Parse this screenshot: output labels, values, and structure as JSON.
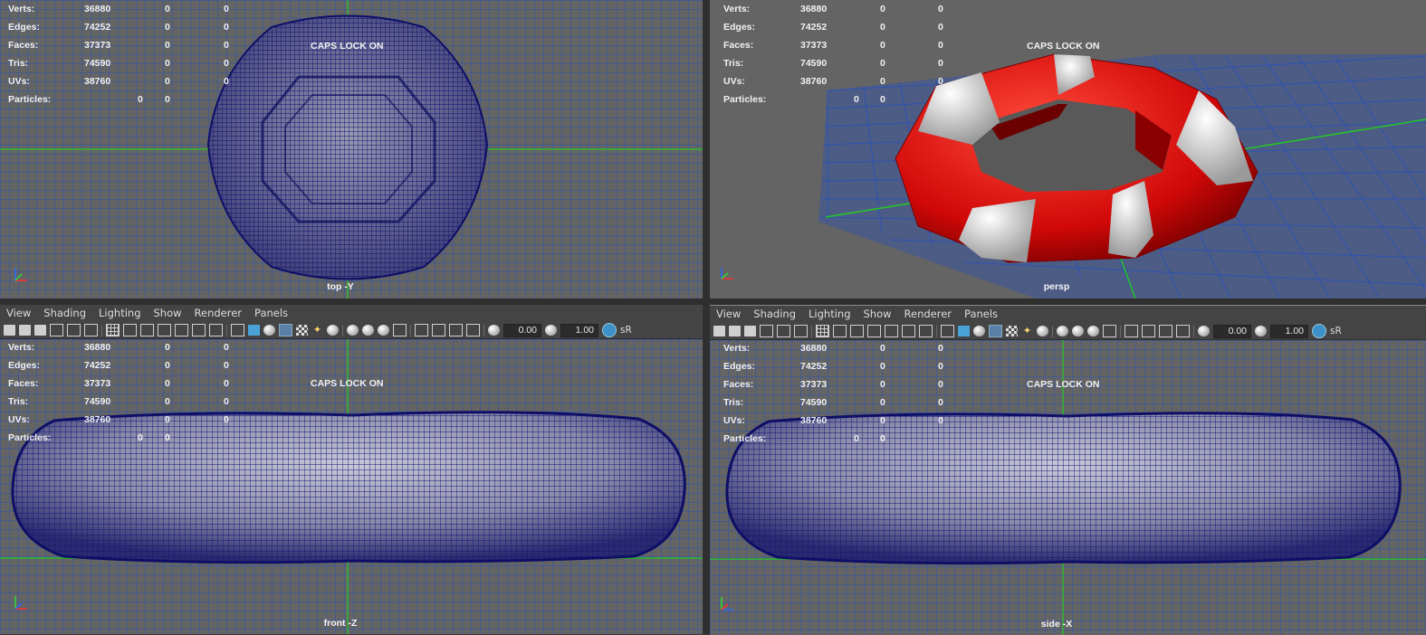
{
  "hud": {
    "rows": [
      {
        "label": "Verts:",
        "v1": "36880",
        "v2": "0",
        "v3": "0"
      },
      {
        "label": "Edges:",
        "v1": "74252",
        "v2": "0",
        "v3": "0"
      },
      {
        "label": "Faces:",
        "v1": "37373",
        "v2": "0",
        "v3": "0"
      },
      {
        "label": "Tris:",
        "v1": "74590",
        "v2": "0",
        "v3": "0"
      },
      {
        "label": "UVs:",
        "v1": "38760",
        "v2": "0",
        "v3": "0"
      }
    ],
    "particles": {
      "label": "Particles:",
      "v1": "0",
      "v2": "0"
    },
    "caps_lock": "CAPS LOCK ON"
  },
  "viewports": {
    "top": {
      "label": "top -Y"
    },
    "persp": {
      "label": "persp"
    },
    "front": {
      "label": "front -Z"
    },
    "side": {
      "label": "side -X"
    }
  },
  "panel_menu": [
    "View",
    "Shading",
    "Lighting",
    "Show",
    "Renderer",
    "Panels"
  ],
  "toolbar": {
    "field1": "0.00",
    "field2": "1.00",
    "sr_label": "sR"
  },
  "colors": {
    "viewport_bg": "#646464",
    "wire": "#1b1b7a",
    "grid": "#2a52b8",
    "axis_green": "#22cc22",
    "ring_red": "#e01010",
    "ring_white": "#d8d8d8"
  }
}
